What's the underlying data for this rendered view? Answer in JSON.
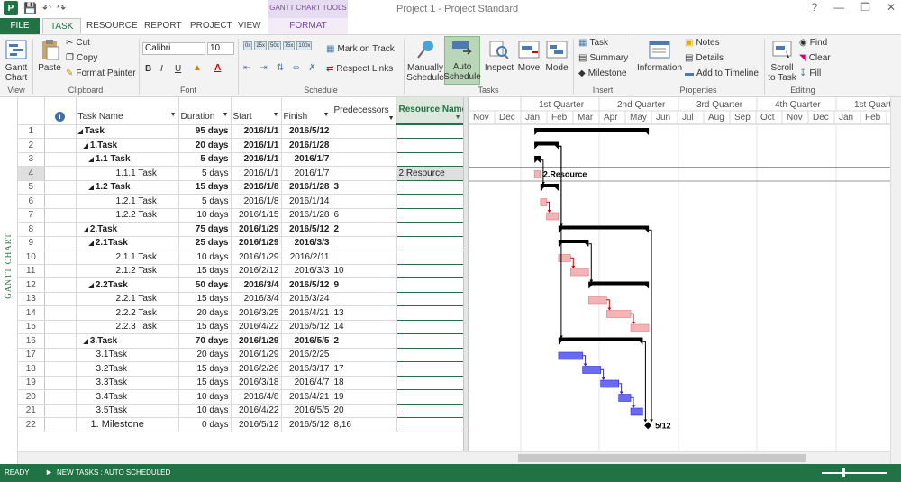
{
  "window": {
    "title": "Project 1 - Project Standard",
    "context_tools": "GANTT CHART TOOLS",
    "controls": [
      "?",
      "—",
      "❐",
      "✕"
    ]
  },
  "tabs": [
    "FILE",
    "TASK",
    "RESOURCE",
    "REPORT",
    "PROJECT",
    "VIEW",
    "FORMAT"
  ],
  "ribbon": {
    "view": {
      "button": "Gantt Chart",
      "group": "View"
    },
    "clipboard": {
      "paste": "Paste",
      "cut": "Cut",
      "copy": "Copy",
      "format_painter": "Format Painter",
      "group": "Clipboard"
    },
    "font": {
      "font_name": "Calibri",
      "font_size": "10",
      "bold": "B",
      "italic": "I",
      "underline": "U",
      "group": "Font"
    },
    "schedule": {
      "mark_on_track": "Mark on Track",
      "respect_links": "Respect Links",
      "group": "Schedule",
      "pcts": [
        "0x",
        "25x",
        "50x",
        "75x",
        "100x"
      ]
    },
    "tasks": {
      "manually": "Manually Schedule",
      "auto": "Auto Schedule",
      "inspect": "Inspect",
      "move": "Move",
      "mode": "Mode",
      "group": "Tasks"
    },
    "insert": {
      "task": "Task",
      "summary": "Summary",
      "milestone": "Milestone",
      "group": "Insert"
    },
    "properties": {
      "information": "Information",
      "notes": "Notes",
      "details": "Details",
      "add_to_timeline": "Add to Timeline",
      "group": "Properties"
    },
    "editing": {
      "scroll_to_task": "Scroll to Task",
      "find": "Find",
      "clear": "Clear",
      "fill": "Fill",
      "group": "Editing"
    }
  },
  "view_label": "GANTT CHART",
  "columns": [
    "Task Name",
    "Duration",
    "Start",
    "Finish",
    "Predecessors",
    "Resource Names"
  ],
  "tasks": [
    {
      "id": "1",
      "name": "Task",
      "indent": 0,
      "summary": true,
      "duration": "95 days",
      "start": "2016/1/1",
      "finish": "2016/5/12",
      "pred": "",
      "res": ""
    },
    {
      "id": "2",
      "name": "1.Task",
      "indent": 1,
      "summary": true,
      "duration": "20 days",
      "start": "2016/1/1",
      "finish": "2016/1/28",
      "pred": "",
      "res": ""
    },
    {
      "id": "3",
      "name": "1.1 Task",
      "indent": 2,
      "summary": true,
      "duration": "5 days",
      "start": "2016/1/1",
      "finish": "2016/1/7",
      "pred": "",
      "res": ""
    },
    {
      "id": "4",
      "name": "1.1.1 Task",
      "indent": 3,
      "summary": false,
      "duration": "5 days",
      "start": "2016/1/1",
      "finish": "2016/1/7",
      "pred": "",
      "res": "2.Resource"
    },
    {
      "id": "5",
      "name": "1.2 Task",
      "indent": 2,
      "summary": true,
      "duration": "15 days",
      "start": "2016/1/8",
      "finish": "2016/1/28",
      "pred": "3",
      "res": ""
    },
    {
      "id": "6",
      "name": "1.2.1 Task",
      "indent": 3,
      "summary": false,
      "duration": "5 days",
      "start": "2016/1/8",
      "finish": "2016/1/14",
      "pred": "",
      "res": ""
    },
    {
      "id": "7",
      "name": "1.2.2 Task",
      "indent": 3,
      "summary": false,
      "duration": "10 days",
      "start": "2016/1/15",
      "finish": "2016/1/28",
      "pred": "6",
      "res": ""
    },
    {
      "id": "8",
      "name": "2.Task",
      "indent": 1,
      "summary": true,
      "duration": "75 days",
      "start": "2016/1/29",
      "finish": "2016/5/12",
      "pred": "2",
      "res": ""
    },
    {
      "id": "9",
      "name": "2.1Task",
      "indent": 2,
      "summary": true,
      "duration": "25 days",
      "start": "2016/1/29",
      "finish": "2016/3/3",
      "pred": "",
      "res": ""
    },
    {
      "id": "10",
      "name": "2.1.1 Task",
      "indent": 3,
      "summary": false,
      "duration": "10 days",
      "start": "2016/1/29",
      "finish": "2016/2/11",
      "pred": "",
      "res": ""
    },
    {
      "id": "11",
      "name": "2.1.2 Task",
      "indent": 3,
      "summary": false,
      "duration": "15 days",
      "start": "2016/2/12",
      "finish": "2016/3/3",
      "pred": "10",
      "res": ""
    },
    {
      "id": "12",
      "name": "2.2Task",
      "indent": 2,
      "summary": true,
      "duration": "50 days",
      "start": "2016/3/4",
      "finish": "2016/5/12",
      "pred": "9",
      "res": ""
    },
    {
      "id": "13",
      "name": "2.2.1 Task",
      "indent": 3,
      "summary": false,
      "duration": "15 days",
      "start": "2016/3/4",
      "finish": "2016/3/24",
      "pred": "",
      "res": ""
    },
    {
      "id": "14",
      "name": "2.2.2 Task",
      "indent": 3,
      "summary": false,
      "duration": "20 days",
      "start": "2016/3/25",
      "finish": "2016/4/21",
      "pred": "13",
      "res": ""
    },
    {
      "id": "15",
      "name": "2.2.3 Task",
      "indent": 3,
      "summary": false,
      "duration": "15 days",
      "start": "2016/4/22",
      "finish": "2016/5/12",
      "pred": "14",
      "res": ""
    },
    {
      "id": "16",
      "name": "3.Task",
      "indent": 1,
      "summary": true,
      "duration": "70 days",
      "start": "2016/1/29",
      "finish": "2016/5/5",
      "pred": "2",
      "res": ""
    },
    {
      "id": "17",
      "name": "3.1Task",
      "indent": 2,
      "summary": false,
      "duration": "20 days",
      "start": "2016/1/29",
      "finish": "2016/2/25",
      "pred": "",
      "res": ""
    },
    {
      "id": "18",
      "name": "3.2Task",
      "indent": 2,
      "summary": false,
      "duration": "15 days",
      "start": "2016/2/26",
      "finish": "2016/3/17",
      "pred": "17",
      "res": ""
    },
    {
      "id": "19",
      "name": "3.3Task",
      "indent": 2,
      "summary": false,
      "duration": "15 days",
      "start": "2016/3/18",
      "finish": "2016/4/7",
      "pred": "18",
      "res": ""
    },
    {
      "id": "20",
      "name": "3.4Task",
      "indent": 2,
      "summary": false,
      "duration": "10 days",
      "start": "2016/4/8",
      "finish": "2016/4/21",
      "pred": "19",
      "res": ""
    },
    {
      "id": "21",
      "name": "3.5Task",
      "indent": 2,
      "summary": false,
      "duration": "10 days",
      "start": "2016/4/22",
      "finish": "2016/5/5",
      "pred": "20",
      "res": ""
    },
    {
      "id": "22",
      "name": "1. Milestone",
      "indent": 1,
      "summary": false,
      "milestone": true,
      "duration": "0 days",
      "start": "2016/5/12",
      "finish": "2016/5/12",
      "pred": "8,16",
      "res": ""
    }
  ],
  "selected_row": "4",
  "timescale": {
    "quarters": [
      "n Quarter",
      "1st Quarter",
      "2nd Quarter",
      "3rd Quarter",
      "4th Quarter",
      "1st Quarter"
    ],
    "months": [
      "Nov",
      "Dec",
      "Jan",
      "Feb",
      "Mar",
      "Apr",
      "May",
      "Jun",
      "Jul",
      "Aug",
      "Sep",
      "Oct",
      "Nov",
      "Dec",
      "Jan",
      "Feb"
    ]
  },
  "bar_labels": {
    "resource": "2.Resource",
    "milestone": "5/12"
  },
  "colors": {
    "brand": "#217346",
    "critical": "#f4b3b5",
    "normal": "#6b6bf0",
    "summary": "#000000"
  },
  "status": {
    "ready": "READY",
    "mode": "NEW TASKS : AUTO SCHEDULED"
  }
}
